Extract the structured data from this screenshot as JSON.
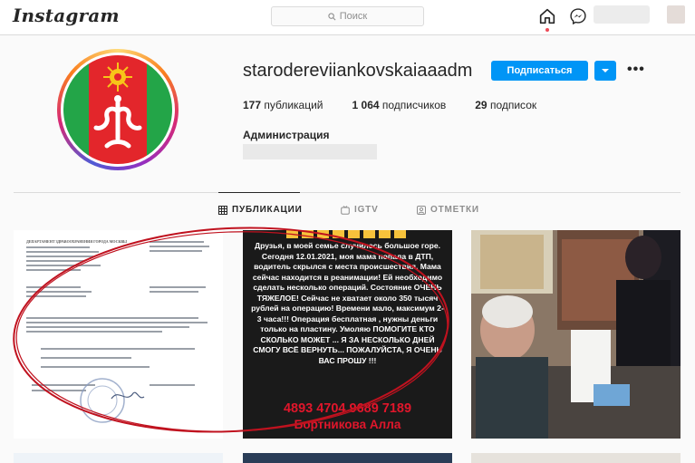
{
  "header": {
    "logo": "Instagram",
    "search_placeholder": "Поиск"
  },
  "profile": {
    "username": "starodereviiankovskaiaaadm",
    "follow_label": "Подписаться",
    "stats": {
      "posts_count": "177",
      "posts_label": " публикаций",
      "followers_count": "1 064",
      "followers_label": " подписчиков",
      "following_count": "29",
      "following_label": " подписок"
    },
    "full_name": "Администрация"
  },
  "tabs": [
    {
      "label": "ПУБЛИКАЦИИ",
      "active": true,
      "icon": "grid-icon"
    },
    {
      "label": "IGTV",
      "active": false,
      "icon": "igtv-icon"
    },
    {
      "label": "ОТМЕТКИ",
      "active": false,
      "icon": "tagged-icon"
    }
  ],
  "posts": {
    "post2": {
      "text": "Друзья, в моей семье случилось большое горе. Сегодня 12.01.2021, моя мама попала в ДТП, водитель скрылся с места происшествия. Мама сейчас находится в реанимации! Ей необходимо сделать несколько операций. Состояние ОЧЕНЬ ТЯЖЕЛОЕ! Сейчас не хватает около 350 тысяч рублей на операцию! Времени мало, максимум 2-3 часа!!! Операция бесплатная , нужны деньги только на пластину. Умоляю ПОМОГИТЕ КТО СКОЛЬКО МОЖЕТ ... Я ЗА НЕСКОЛЬКО ДНЕЙ СМОГУ ВСЁ ВЕРНУТЬ... ПОЖАЛУЙСТА, Я ОЧЕНЬ ВАС ПРОШУ !!!",
      "phone": "4893 4704 9689 7189",
      "name": "Бортникова Алла"
    },
    "post1": {
      "doc_header": "ДЕПАРТАМЕНТ ЗДРАВООХРАНЕНИЯ ГОРОДА МОСКВЫ"
    }
  },
  "colors": {
    "follow_button": "#0095f6",
    "annotation_ellipse": "#c0121f",
    "post_text_red": "#e0162b"
  }
}
